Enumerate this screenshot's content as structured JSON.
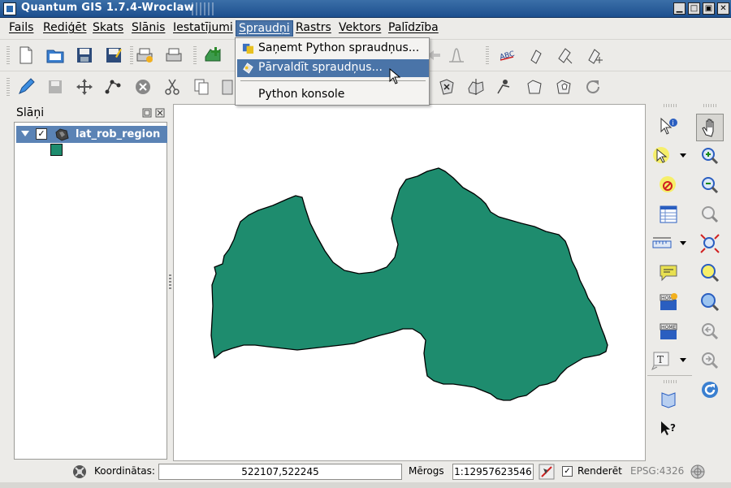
{
  "window": {
    "title": "Quantum GIS 1.7.4-Wroclaw",
    "controls": [
      "▁",
      "□",
      "▣",
      "✕"
    ]
  },
  "menubar": [
    "Fails",
    "Rediģēt",
    "Skats",
    "Slānis",
    "Iestatījumi",
    "Spraudņi",
    "Rastrs",
    "Vektors",
    "Palīdzība"
  ],
  "plugins_menu": {
    "items": [
      "Saņemt Python spraudņus...",
      "Pārvaldīt spraudņus...",
      "Python konsole"
    ]
  },
  "layers_panel": {
    "title": "Slāņi",
    "layer_name": "lat_rob_region",
    "checked": "✓"
  },
  "statusbar": {
    "coord_label": "Koordinātas:",
    "coord_value": "522107,522245",
    "scale_label": "Mērogs",
    "scale_value": "1:12957623546",
    "render_label": "Renderēt",
    "render_checked": "✓",
    "epsg": "EPSG:4326"
  },
  "colors": {
    "region_fill": "#1e8c6e",
    "highlight": "#4a74a8",
    "title_bar": "#2a5d9c"
  }
}
